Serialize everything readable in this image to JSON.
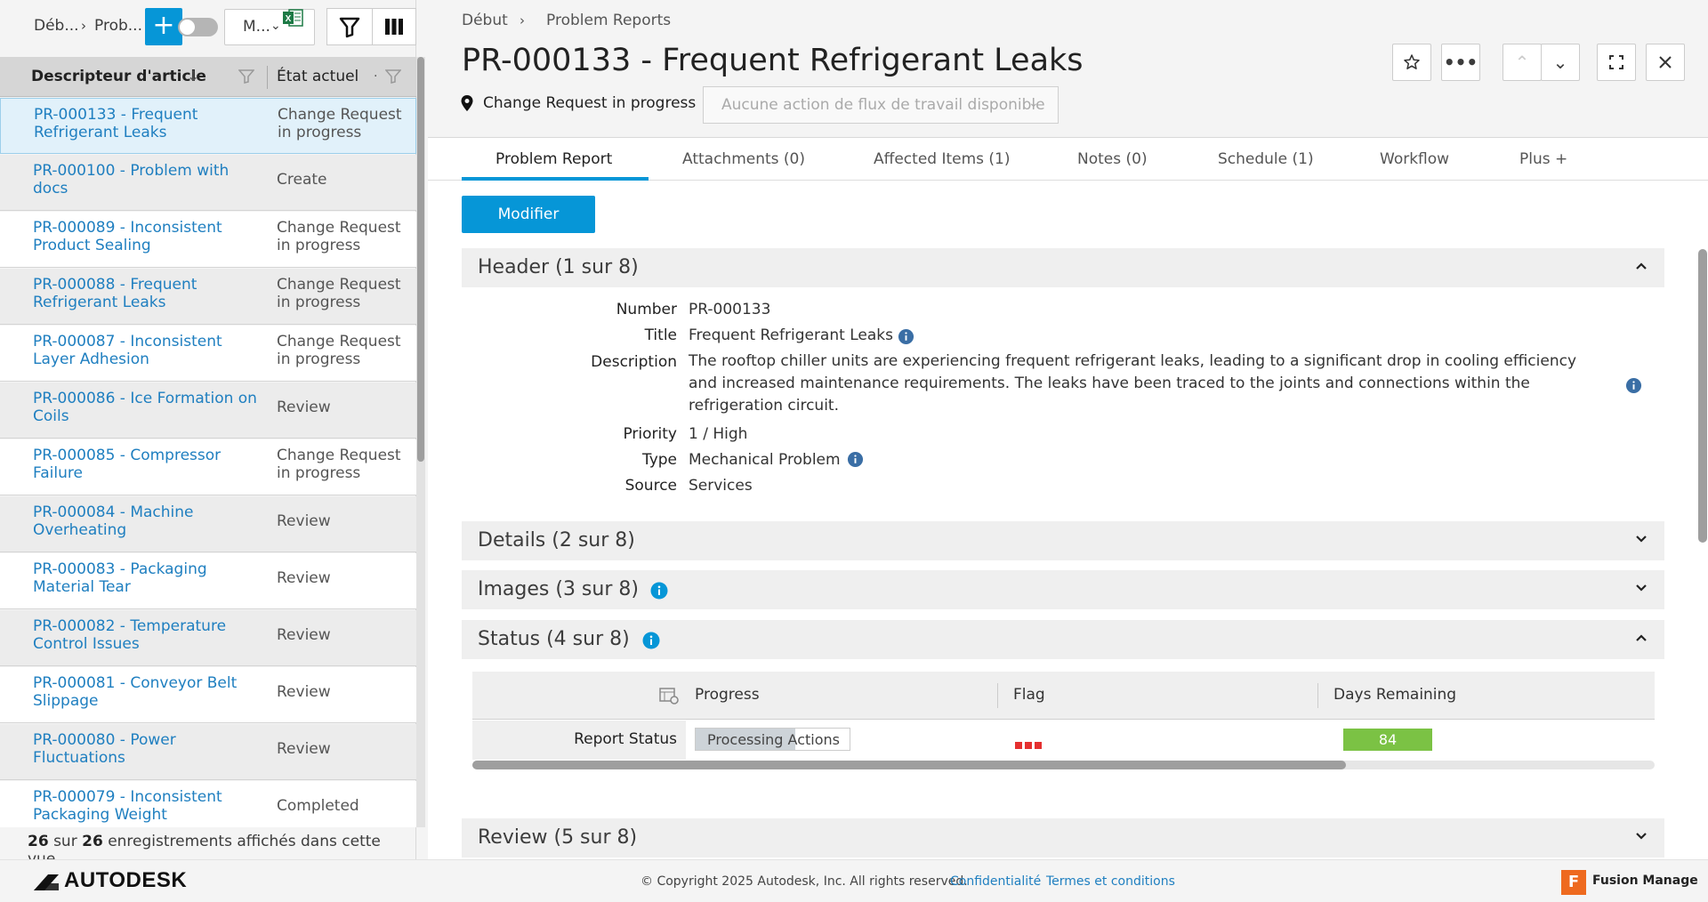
{
  "left": {
    "breadcrumb": [
      "Déb...",
      "Prob..."
    ],
    "add_label": "+",
    "view_label": "M...",
    "columns": {
      "descriptor": "Descripteur d'article",
      "state": "État actuel"
    },
    "rows": [
      {
        "desc": "PR-000133 - Frequent Refrigerant Leaks",
        "state": "Change Request in progress"
      },
      {
        "desc": "PR-000100 - Problem with docs",
        "state": "Create"
      },
      {
        "desc": "PR-000089 - Inconsistent Product Sealing",
        "state": "Change Request in progress"
      },
      {
        "desc": "PR-000088 - Frequent Refrigerant Leaks",
        "state": "Change Request in progress"
      },
      {
        "desc": "PR-000087 - Inconsistent Layer Adhesion",
        "state": "Change Request in progress"
      },
      {
        "desc": "PR-000086 - Ice Formation on Coils",
        "state": "Review"
      },
      {
        "desc": "PR-000085 - Compressor Failure",
        "state": "Change Request in progress"
      },
      {
        "desc": "PR-000084 - Machine Overheating",
        "state": "Review"
      },
      {
        "desc": "PR-000083 - Packaging Material Tear",
        "state": "Review"
      },
      {
        "desc": "PR-000082 - Temperature Control Issues",
        "state": "Review"
      },
      {
        "desc": "PR-000081 - Conveyor Belt Slippage",
        "state": "Review"
      },
      {
        "desc": "PR-000080 - Power Fluctuations",
        "state": "Review"
      },
      {
        "desc": "PR-000079 - Inconsistent Packaging Weight",
        "state": "Completed"
      }
    ],
    "count": {
      "shown": "26",
      "sep": "sur",
      "total": "26",
      "suffix": "enregistrements affichés dans cette vue."
    }
  },
  "right": {
    "breadcrumb": [
      "Début",
      "Problem Reports"
    ],
    "title": "PR-000133 - Frequent Refrigerant Leaks",
    "status": "Change Request in progress",
    "workflow_placeholder": "Aucune action de flux de travail disponible",
    "tabs": [
      "Problem Report",
      "Attachments (0)",
      "Affected Items (1)",
      "Notes (0)",
      "Schedule (1)",
      "Workflow",
      "Plus +"
    ],
    "edit_label": "Modifier",
    "sections": {
      "header": "Header (1 sur 8)",
      "details": "Details (2 sur 8)",
      "images": "Images (3 sur 8)",
      "status": "Status (4 sur 8)",
      "review": "Review (5 sur 8)"
    },
    "fields": {
      "number_label": "Number",
      "number": "PR-000133",
      "title_label": "Title",
      "title": "Frequent Refrigerant Leaks",
      "description_label": "Description",
      "description": "The rooftop chiller units are experiencing frequent refrigerant leaks, leading to a significant drop in cooling efficiency and increased maintenance requirements. The leaks have been traced to the joints and connections within the refrigeration circuit.",
      "priority_label": "Priority",
      "priority": "1 / High",
      "type_label": "Type",
      "type": "Mechanical Problem",
      "source_label": "Source",
      "source": "Services"
    },
    "status_table": {
      "columns": [
        "Progress",
        "Flag",
        "Days Remaining"
      ],
      "row_label": "Report Status",
      "progress_text": "Processing Actions",
      "progress_fraction": 0.65,
      "days_remaining": "84",
      "days_color": "#7bc244",
      "flag_color": "#e53030"
    }
  },
  "footer": {
    "brand": "AUTODESK",
    "copyright": "© Copyright 2025 Autodesk, Inc. All rights reserved.",
    "privacy": "Confidentialité",
    "terms": "Termes et conditions",
    "product": "Fusion Manage",
    "product_icon": "F"
  },
  "colors": {
    "accent": "#0696d7",
    "link": "#1f7fc0"
  }
}
